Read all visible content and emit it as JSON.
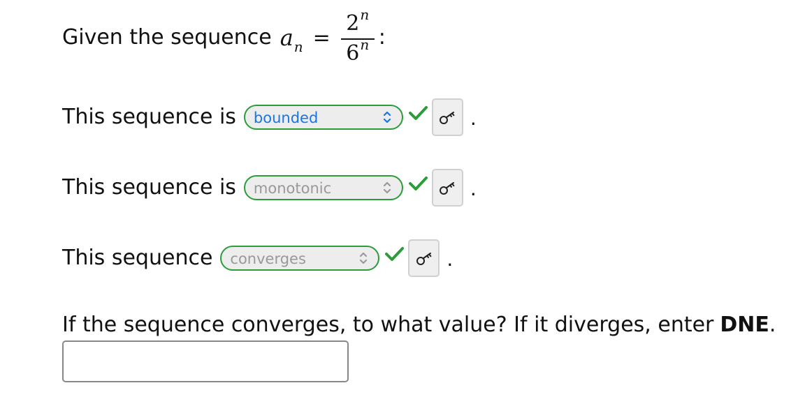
{
  "intro": {
    "text": "Given the sequence",
    "formula": {
      "term_variable": "a",
      "term_subscript": "n",
      "equals": "=",
      "numerator_base": "2",
      "numerator_exponent": "n",
      "denominator_base": "6",
      "denominator_exponent": "n",
      "suffix": ":"
    }
  },
  "questions": [
    {
      "prompt": "This sequence is",
      "selected_value": "bounded",
      "status": "correct",
      "icon": "key-icon",
      "trailing": "."
    },
    {
      "prompt": "This sequence is",
      "selected_value": "monotonic",
      "status": "correct",
      "icon": "key-icon",
      "trailing": "."
    },
    {
      "prompt": "This sequence",
      "selected_value": "converges",
      "status": "correct",
      "icon": "key-icon",
      "trailing": "."
    }
  ],
  "answer": {
    "instruction_text": "If the sequence converges, to what value? If it diverges, enter",
    "instruction_strong": "DNE",
    "instruction_suffix": ".",
    "input_value": "",
    "placeholder": ""
  },
  "colors": {
    "correct": "#2a9d39",
    "active_select_text": "#1876e8",
    "inactive_select_text": "#999999",
    "select_background": "#ededed",
    "button_background": "#efefef",
    "button_border": "#d0d0d0",
    "input_border": "#888888"
  },
  "icons": {
    "select_indicator": "up-down-chevron-icon",
    "correct": "checkmark-icon",
    "answer_key": "key-icon"
  }
}
